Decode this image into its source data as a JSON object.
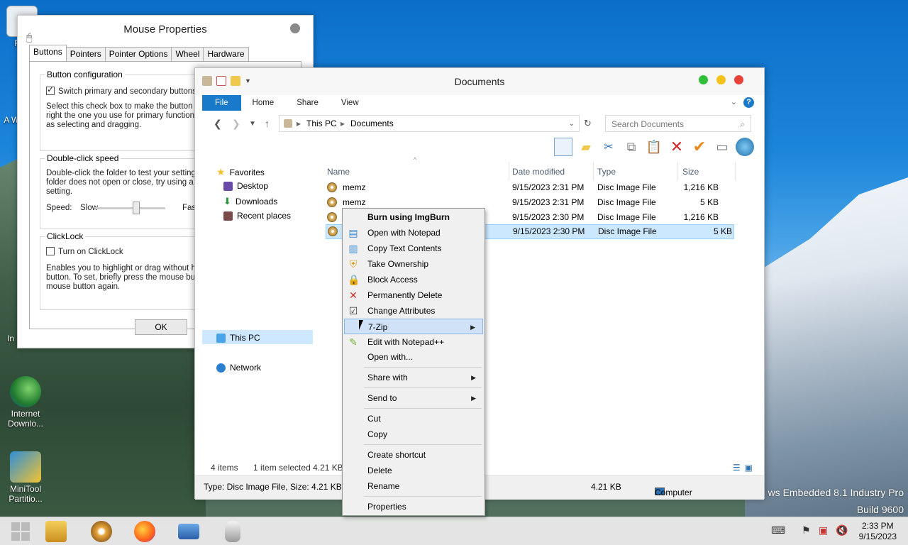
{
  "desktop": {
    "watermark_line1": "ws Embedded 8.1 Industry Pro",
    "watermark_line2": "Build 9600",
    "icons": [
      {
        "label": "Rec",
        "id": "recycle"
      },
      {
        "label": "A Win",
        "id": "app1"
      },
      {
        "label": "In",
        "id": "app2"
      },
      {
        "label": "Internet Downlo...",
        "id": "idm"
      },
      {
        "label": "MiniTool Partitio...",
        "id": "minitool"
      }
    ]
  },
  "mouse_properties": {
    "title": "Mouse Properties",
    "tabs": [
      "Buttons",
      "Pointers",
      "Pointer Options",
      "Wheel",
      "Hardware"
    ],
    "button_config": {
      "group_label": "Button configuration",
      "checkbox_label": "Switch primary and secondary buttons",
      "checked": true,
      "desc_line1": "Select this check box to make the button on",
      "desc_line2": "right the one you use for primary functions su",
      "desc_line3": "as selecting and dragging."
    },
    "double_click": {
      "group_label": "Double-click speed",
      "desc_line1": "Double-click the folder to test your setting. If t",
      "desc_line2": "folder does not open or close, try using a slow",
      "desc_line3": "setting.",
      "speed_label": "Speed:",
      "slow_label": "Slow",
      "fast_label": "Fast"
    },
    "clicklock": {
      "group_label": "ClickLock",
      "checkbox_label": "Turn on ClickLock",
      "checked": false,
      "desc_line1": "Enables you to highlight or drag without holdi",
      "desc_line2": "button. To set, briefly press the mouse button",
      "desc_line3": "mouse button again."
    },
    "ok_label": "OK"
  },
  "explorer": {
    "title": "Documents",
    "ribbon_tabs": [
      "File",
      "Home",
      "Share",
      "View"
    ],
    "help_label": "?",
    "breadcrumb": [
      "This PC",
      "Documents"
    ],
    "search_placeholder": "Search Documents",
    "nav": {
      "favorites": "Favorites",
      "desktop": "Desktop",
      "downloads": "Downloads",
      "recent": "Recent places",
      "this_pc": "This PC",
      "network": "Network"
    },
    "columns": [
      "Name",
      "Date modified",
      "Type",
      "Size"
    ],
    "files": [
      {
        "name": "memz",
        "date": "9/15/2023 2:31 PM",
        "type": "Disc Image File",
        "size": "1,216 KB"
      },
      {
        "name": "memz",
        "date": "9/15/2023 2:31 PM",
        "type": "Disc Image File",
        "size": "5 KB"
      },
      {
        "name": "",
        "date": "9/15/2023 2:30 PM",
        "type": "Disc Image File",
        "size": "1,216 KB"
      },
      {
        "name": "",
        "date": "9/15/2023 2:30 PM",
        "type": "Disc Image File",
        "size": "5 KB"
      }
    ],
    "status_items": "4 items",
    "status_selected": "1 item selected  4.21 KB",
    "detail_type": "Type: Disc Image File, Size: 4.21 KB, D",
    "detail_size": "4.21 KB",
    "detail_location": "Computer"
  },
  "context_menu": {
    "items": [
      {
        "label": "Burn using ImgBurn",
        "icon": "disc-icon"
      },
      {
        "label": "Open with Notepad",
        "icon": "notepad-icon"
      },
      {
        "label": "Copy Text Contents",
        "icon": "copy-text-icon"
      },
      {
        "label": "Take Ownership",
        "icon": "shield-icon"
      },
      {
        "label": "Block Access",
        "icon": "lock-icon"
      },
      {
        "label": "Permanently Delete",
        "icon": "delete-icon"
      },
      {
        "label": "Change Attributes",
        "icon": "check-icon"
      },
      {
        "label": "7-Zip",
        "icon": ""
      },
      {
        "label": "Edit with Notepad++",
        "icon": "notepadpp-icon"
      },
      {
        "label": "Open with...",
        "icon": ""
      },
      {
        "label": "Share with",
        "icon": ""
      },
      {
        "label": "Send to",
        "icon": ""
      },
      {
        "label": "Cut",
        "icon": ""
      },
      {
        "label": "Copy",
        "icon": ""
      },
      {
        "label": "Create shortcut",
        "icon": ""
      },
      {
        "label": "Delete",
        "icon": ""
      },
      {
        "label": "Rename",
        "icon": ""
      },
      {
        "label": "Properties",
        "icon": ""
      }
    ]
  },
  "taskbar": {
    "time": "2:33 PM",
    "date": "9/15/2023"
  }
}
